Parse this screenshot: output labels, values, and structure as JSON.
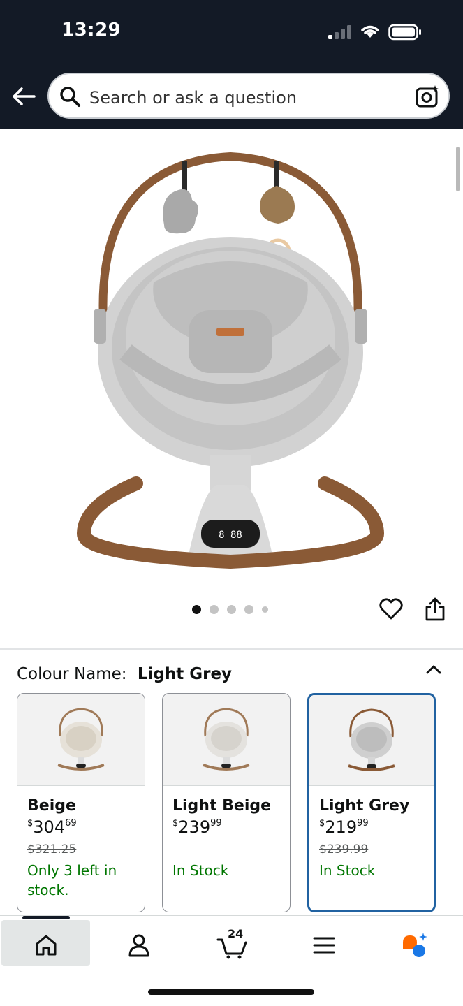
{
  "status_bar": {
    "time": "13:29"
  },
  "search": {
    "placeholder": "Search or ask a question"
  },
  "gallery": {
    "image_count": 5,
    "active_index": 0
  },
  "colour": {
    "label": "Colour Name:",
    "selected": "Light Grey",
    "options": [
      {
        "name": "Beige",
        "price_symbol": "$",
        "price_whole": "304",
        "price_fraction": "69",
        "was_price": "$321.25",
        "stock": "Only 3 left in stock."
      },
      {
        "name": "Light Beige",
        "price_symbol": "$",
        "price_whole": "239",
        "price_fraction": "99",
        "was_price": "",
        "stock": "In Stock"
      },
      {
        "name": "Light Grey",
        "price_symbol": "$",
        "price_whole": "219",
        "price_fraction": "99",
        "was_price": "$239.99",
        "stock": "In Stock"
      }
    ]
  },
  "bottom_nav": {
    "cart_count": "24",
    "items": [
      "home-icon",
      "account-icon",
      "cart-icon",
      "menu-icon",
      "rufus-icon"
    ]
  },
  "colors": {
    "header_bg": "#131a26",
    "selected_border": "#2162a1",
    "in_stock": "#007600"
  }
}
